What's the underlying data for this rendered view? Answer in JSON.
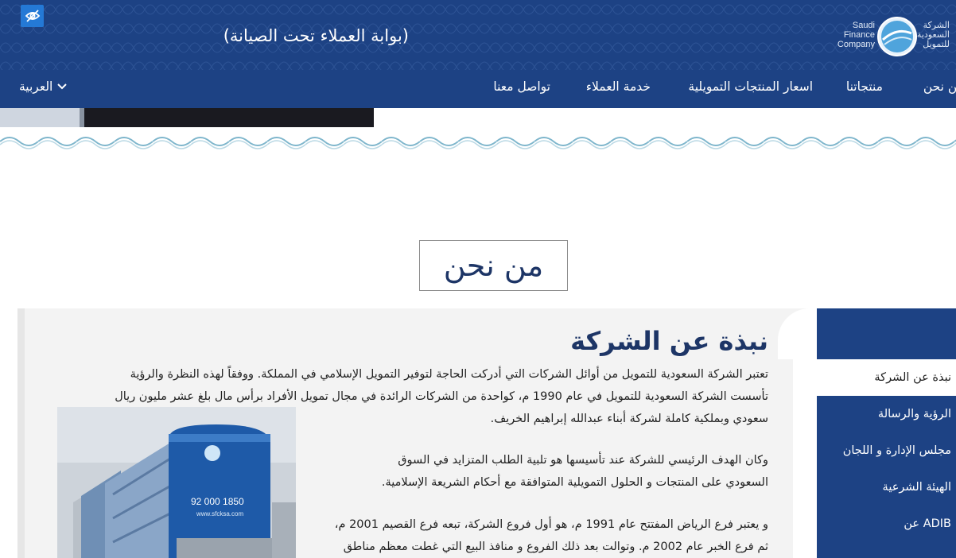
{
  "header": {
    "maintenance_title": "(بوابة العملاء تحت الصيانة)",
    "logo": {
      "en_lines": [
        "Saudi",
        "Finance",
        "Company"
      ],
      "ar_lines": [
        "الشركة",
        "السعودية",
        "للتمويل"
      ]
    },
    "accessibility_icon": "eye-off-icon"
  },
  "nav": {
    "items": [
      "من نحن",
      "منتجاتنا",
      "اسعار المنتجات التمويلية",
      "خدمة العملاء",
      "تواصل معنا"
    ],
    "language": "العربية"
  },
  "page": {
    "section_title": "من نحن"
  },
  "content": {
    "heading": "نبذة عن الشركة",
    "p1": "تعتبر الشركة السعودية للتمويل من أوائل الشركات التي أدركت الحاجة لتوفير التمويل الإسلامي في المملكة. ووفقاً لهذه النظرة والرؤية",
    "p2": "تأسست الشركة السعودية للتمويل في عام 1990 م، كواحدة من الشركات الرائدة في مجال تمويل الأفراد برأس مال بلغ عشر مليون ريال",
    "p3": "سعودي وبملكية كاملة لشركة أبناء عبدالله إبراهيم الخريف.",
    "p4": "وكان الهدف الرئيسي للشركة عند تأسيسها هو تلبية الطلب المتزايد في السوق",
    "p5": "السعودي على المنتجات و الحلول التمويلية المتوافقة مع أحكام الشريعة الإسلامية.",
    "p6": "و يعتبر فرع الرياض المفتتح عام 1991 م، هو أول فروع الشركة، تبعه فرع القصيم 2001 م،",
    "p7": "ثم فرع الخبر عام 2002 م. وتوالت بعد ذلك الفروع و منافذ البيع التي غطت معظم مناطق",
    "building_phone": "92 000 1850",
    "building_url": "www.sfcksa.com"
  },
  "sidebar": {
    "items": [
      "نبذة عن الشركة",
      "الرؤية والرسالة",
      "مجلس الإدارة و اللجان",
      "الهيئة الشرعية",
      "ADIB عن"
    ]
  },
  "colors": {
    "brand_blue": "#1d4284",
    "accent_blue": "#2479d6",
    "heading": "#1d3566",
    "panel": "#f3f3f3"
  }
}
